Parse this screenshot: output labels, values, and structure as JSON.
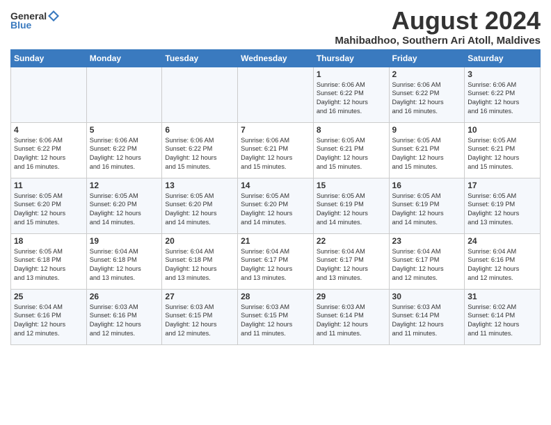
{
  "header": {
    "logo_general": "General",
    "logo_blue": "Blue",
    "month_title": "August 2024",
    "subtitle": "Mahibadhoo, Southern Ari Atoll, Maldives"
  },
  "days_of_week": [
    "Sunday",
    "Monday",
    "Tuesday",
    "Wednesday",
    "Thursday",
    "Friday",
    "Saturday"
  ],
  "weeks": [
    [
      {
        "day": "",
        "info": ""
      },
      {
        "day": "",
        "info": ""
      },
      {
        "day": "",
        "info": ""
      },
      {
        "day": "",
        "info": ""
      },
      {
        "day": "1",
        "info": "Sunrise: 6:06 AM\nSunset: 6:22 PM\nDaylight: 12 hours\nand 16 minutes."
      },
      {
        "day": "2",
        "info": "Sunrise: 6:06 AM\nSunset: 6:22 PM\nDaylight: 12 hours\nand 16 minutes."
      },
      {
        "day": "3",
        "info": "Sunrise: 6:06 AM\nSunset: 6:22 PM\nDaylight: 12 hours\nand 16 minutes."
      }
    ],
    [
      {
        "day": "4",
        "info": "Sunrise: 6:06 AM\nSunset: 6:22 PM\nDaylight: 12 hours\nand 16 minutes."
      },
      {
        "day": "5",
        "info": "Sunrise: 6:06 AM\nSunset: 6:22 PM\nDaylight: 12 hours\nand 16 minutes."
      },
      {
        "day": "6",
        "info": "Sunrise: 6:06 AM\nSunset: 6:22 PM\nDaylight: 12 hours\nand 15 minutes."
      },
      {
        "day": "7",
        "info": "Sunrise: 6:06 AM\nSunset: 6:21 PM\nDaylight: 12 hours\nand 15 minutes."
      },
      {
        "day": "8",
        "info": "Sunrise: 6:05 AM\nSunset: 6:21 PM\nDaylight: 12 hours\nand 15 minutes."
      },
      {
        "day": "9",
        "info": "Sunrise: 6:05 AM\nSunset: 6:21 PM\nDaylight: 12 hours\nand 15 minutes."
      },
      {
        "day": "10",
        "info": "Sunrise: 6:05 AM\nSunset: 6:21 PM\nDaylight: 12 hours\nand 15 minutes."
      }
    ],
    [
      {
        "day": "11",
        "info": "Sunrise: 6:05 AM\nSunset: 6:20 PM\nDaylight: 12 hours\nand 15 minutes."
      },
      {
        "day": "12",
        "info": "Sunrise: 6:05 AM\nSunset: 6:20 PM\nDaylight: 12 hours\nand 14 minutes."
      },
      {
        "day": "13",
        "info": "Sunrise: 6:05 AM\nSunset: 6:20 PM\nDaylight: 12 hours\nand 14 minutes."
      },
      {
        "day": "14",
        "info": "Sunrise: 6:05 AM\nSunset: 6:20 PM\nDaylight: 12 hours\nand 14 minutes."
      },
      {
        "day": "15",
        "info": "Sunrise: 6:05 AM\nSunset: 6:19 PM\nDaylight: 12 hours\nand 14 minutes."
      },
      {
        "day": "16",
        "info": "Sunrise: 6:05 AM\nSunset: 6:19 PM\nDaylight: 12 hours\nand 14 minutes."
      },
      {
        "day": "17",
        "info": "Sunrise: 6:05 AM\nSunset: 6:19 PM\nDaylight: 12 hours\nand 13 minutes."
      }
    ],
    [
      {
        "day": "18",
        "info": "Sunrise: 6:05 AM\nSunset: 6:18 PM\nDaylight: 12 hours\nand 13 minutes."
      },
      {
        "day": "19",
        "info": "Sunrise: 6:04 AM\nSunset: 6:18 PM\nDaylight: 12 hours\nand 13 minutes."
      },
      {
        "day": "20",
        "info": "Sunrise: 6:04 AM\nSunset: 6:18 PM\nDaylight: 12 hours\nand 13 minutes."
      },
      {
        "day": "21",
        "info": "Sunrise: 6:04 AM\nSunset: 6:17 PM\nDaylight: 12 hours\nand 13 minutes."
      },
      {
        "day": "22",
        "info": "Sunrise: 6:04 AM\nSunset: 6:17 PM\nDaylight: 12 hours\nand 13 minutes."
      },
      {
        "day": "23",
        "info": "Sunrise: 6:04 AM\nSunset: 6:17 PM\nDaylight: 12 hours\nand 12 minutes."
      },
      {
        "day": "24",
        "info": "Sunrise: 6:04 AM\nSunset: 6:16 PM\nDaylight: 12 hours\nand 12 minutes."
      }
    ],
    [
      {
        "day": "25",
        "info": "Sunrise: 6:04 AM\nSunset: 6:16 PM\nDaylight: 12 hours\nand 12 minutes."
      },
      {
        "day": "26",
        "info": "Sunrise: 6:03 AM\nSunset: 6:16 PM\nDaylight: 12 hours\nand 12 minutes."
      },
      {
        "day": "27",
        "info": "Sunrise: 6:03 AM\nSunset: 6:15 PM\nDaylight: 12 hours\nand 12 minutes."
      },
      {
        "day": "28",
        "info": "Sunrise: 6:03 AM\nSunset: 6:15 PM\nDaylight: 12 hours\nand 11 minutes."
      },
      {
        "day": "29",
        "info": "Sunrise: 6:03 AM\nSunset: 6:14 PM\nDaylight: 12 hours\nand 11 minutes."
      },
      {
        "day": "30",
        "info": "Sunrise: 6:03 AM\nSunset: 6:14 PM\nDaylight: 12 hours\nand 11 minutes."
      },
      {
        "day": "31",
        "info": "Sunrise: 6:02 AM\nSunset: 6:14 PM\nDaylight: 12 hours\nand 11 minutes."
      }
    ]
  ]
}
